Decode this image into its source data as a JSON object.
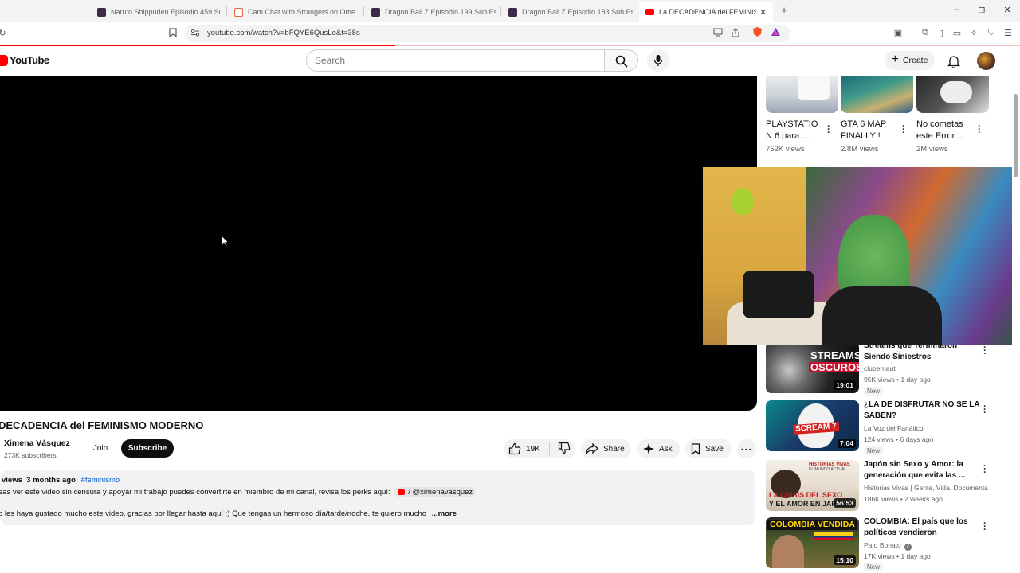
{
  "browser": {
    "tabs": [
      {
        "label": "Naruto Shippuden Episodio 459 Sub",
        "color": "#3b2a4a"
      },
      {
        "label": "Cam Chat with Strangers on OmeTV",
        "color": "#e8623a"
      },
      {
        "label": "Dragon Ball Z Episodio 199 Sub Espa",
        "color": "#3b2a4a"
      },
      {
        "label": "Dragon Ball Z Episodio 183 Sub Espa",
        "color": "#3b2a4a"
      },
      {
        "label": "La DECADENCIA del FEMINISMO",
        "color": "#ff0000"
      }
    ],
    "url": "youtube.com/watch?v=bFQYE6QusLo&t=38s"
  },
  "header": {
    "logo": "YouTube",
    "search_placeholder": "Search",
    "create_label": "Create"
  },
  "video": {
    "title": "DECADENCIA del FEMINISMO MODERNO",
    "channel": "Ximena Vásquez",
    "subscribers": "273K subscribers",
    "join_label": "Join",
    "subscribe_label": "Subscribe",
    "likes": "19K",
    "share_label": "Share",
    "ask_label": "Ask",
    "save_label": "Save",
    "description": {
      "views": "views",
      "age": "3 months ago",
      "hashtag": "#feminismo",
      "line1": "eas ver este video sin censura y apoyar mi trabajo puedes convertirte en miembro de mi canal, revisa los perks aquí:",
      "mention": "/ @ximenavasquez",
      "line2": "o les haya gustado mucho este video, gracias por llegar hasta aquí :) Que tengas un hermoso día/tarde/noche, te quiero mucho",
      "more": "...more"
    }
  },
  "shorts": [
    {
      "title": "PLAYSTATIO N 6 para ...",
      "views": "752K views"
    },
    {
      "title": "GTA 6 MAP FINALLY !",
      "views": "2.8M views"
    },
    {
      "title": "No cometas este Error ...",
      "views": "2M views"
    }
  ],
  "recommendations": [
    {
      "title": "Streams que Terminaron Siendo Siniestros",
      "channel": "clubernaut",
      "stats": "95K views • 1 day ago",
      "badge": "New",
      "duration": "19:01",
      "thumb_text": [
        "STREAMS",
        "OSCUROS"
      ]
    },
    {
      "title": "¿LA DE DISFRUTAR NO SE LA SABEN?",
      "channel": "La Voz del Fanático",
      "stats": "124 views • 6 days ago",
      "badge": "New",
      "duration": "7:04",
      "thumb_text": [
        "SCREAM 7"
      ]
    },
    {
      "title": "Japón sin Sexo y Amor: la generación que evita las ...",
      "channel": "Historias Vivas | Gente, Vida, Documenta...",
      "stats": "186K views • 2 weeks ago",
      "badge": "",
      "duration": "56:53",
      "thumb_text": [
        "LA CRISIS DEL SEXO",
        "Y EL AMOR EN JAPÓN",
        "HISTORIAS VIVAS",
        "EL MUNDO ACTUAL"
      ]
    },
    {
      "title": "COLOMBIA: El país que los políticos vendieron",
      "channel": "Pato Bonato",
      "stats": "17K views • 1 day ago",
      "badge": "New",
      "duration": "15:10",
      "thumb_text": [
        "COLOMBIA VENDIDA"
      ]
    }
  ],
  "colors": {
    "accent": "#ff0000",
    "link": "#065fd4",
    "dark": "#0f0f0f"
  }
}
